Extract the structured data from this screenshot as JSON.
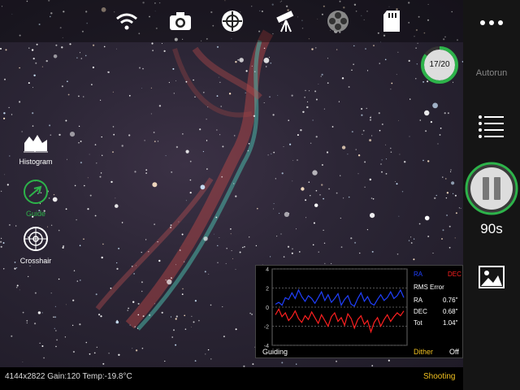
{
  "top_icons": [
    "wifi-icon",
    "camera-icon",
    "focus-crosshair-icon",
    "telescope-icon",
    "filter-wheel-icon",
    "sd-card-icon"
  ],
  "menu_icon": "more-dots-icon",
  "counter": {
    "text": "17/20",
    "progress": 0.85
  },
  "autorun": {
    "label": "Autorun"
  },
  "exposure": {
    "label": "90s"
  },
  "tools": [
    {
      "label": "Histogram",
      "icon": "histogram-icon",
      "active": false
    },
    {
      "label": "Guide",
      "icon": "guide-target-icon",
      "active": true
    },
    {
      "label": "Crosshair",
      "icon": "crosshair-icon",
      "active": false
    }
  ],
  "guiding": {
    "title": "Guiding",
    "legend_ra": "RA",
    "legend_dec": "DEC",
    "rms_title": "RMS Error",
    "rows": [
      {
        "label": "RA",
        "value": "0.76\""
      },
      {
        "label": "DEC",
        "value": "0.68\""
      },
      {
        "label": "Tot",
        "value": "1.04\""
      }
    ],
    "dither_label": "Dither",
    "dither_state": "Off",
    "y_ticks": [
      "4",
      "2",
      "0",
      "-2",
      "-4"
    ]
  },
  "chart_data": {
    "type": "line",
    "ylim": [
      -4,
      4
    ],
    "series": [
      {
        "name": "RA",
        "color": "#2040ff",
        "values": [
          0.3,
          0.5,
          0.2,
          1.0,
          0.8,
          1.5,
          0.9,
          1.8,
          1.1,
          0.6,
          1.2,
          0.9,
          0.4,
          1.0,
          1.6,
          0.7,
          1.3,
          0.5,
          0.9,
          1.4,
          0.2,
          0.8,
          1.2,
          0.3,
          0.1,
          0.9,
          1.5,
          0.6,
          1.1,
          0.4,
          0.2,
          0.8,
          1.3,
          0.7,
          1.0,
          1.6,
          0.9,
          1.2,
          1.8,
          1.0
        ]
      },
      {
        "name": "DEC",
        "color": "#ff2020",
        "values": [
          -0.8,
          -0.2,
          -1.0,
          -0.6,
          -1.4,
          -1.0,
          -0.4,
          -1.2,
          -1.6,
          -0.9,
          -1.3,
          -0.5,
          -1.1,
          -1.7,
          -0.8,
          -1.4,
          -2.0,
          -1.0,
          -0.6,
          -1.5,
          -1.1,
          -1.9,
          -0.7,
          -1.2,
          -2.2,
          -1.3,
          -0.9,
          -1.8,
          -1.4,
          -2.6,
          -1.6,
          -1.1,
          -2.0,
          -1.3,
          -0.8,
          -1.5,
          -1.0,
          -0.6,
          -0.9,
          -0.4
        ]
      }
    ]
  },
  "status": {
    "info": "4144x2822  Gain:120  Temp:-19.8°C",
    "state": "Shooting"
  },
  "colors": {
    "accent_green": "#2db34a",
    "status_yellow": "#f0c020"
  }
}
